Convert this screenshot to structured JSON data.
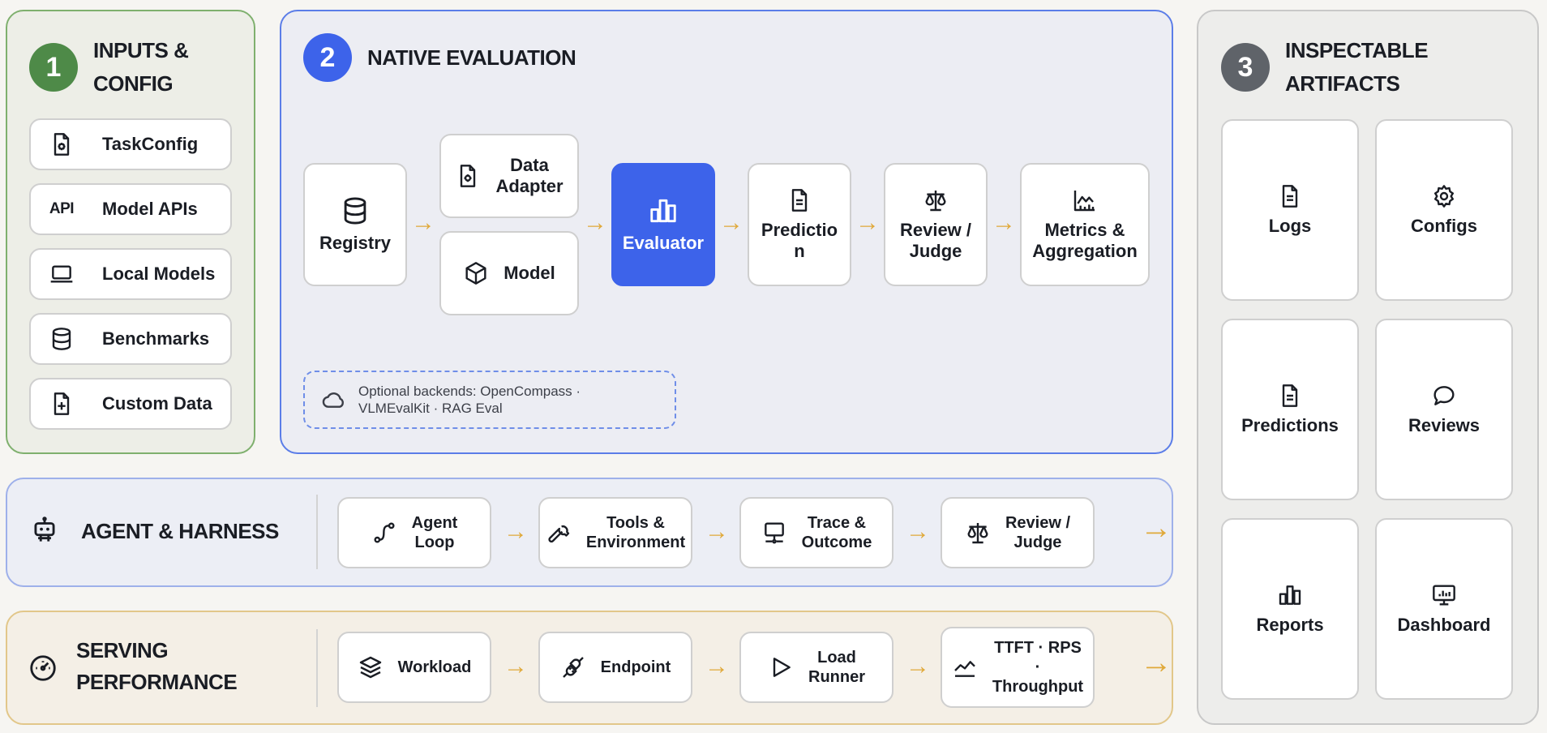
{
  "colors": {
    "inputs_accent": "#4e8a48",
    "native_accent": "#3d63ea",
    "artifacts_accent": "#5f6369",
    "arrow": "#e0a93a"
  },
  "inputs": {
    "number": "1",
    "title_line1": "INPUTS &",
    "title_line2": "CONFIG",
    "items": [
      {
        "label": "TaskConfig",
        "icon": "gear-document-icon"
      },
      {
        "label": "Model APIs",
        "icon": "api-text-icon",
        "icon_text": "API"
      },
      {
        "label": "Local Models",
        "icon": "laptop-icon"
      },
      {
        "label": "Benchmarks",
        "icon": "database-icon"
      },
      {
        "label": "Custom Data",
        "icon": "file-plus-icon"
      }
    ]
  },
  "native": {
    "number": "2",
    "title": "NATIVE EVALUATION",
    "registry": "Registry",
    "data_adapter_line1": "Data",
    "data_adapter_line2": "Adapter",
    "model": "Model",
    "evaluator": "Evaluator",
    "prediction_line1": "Predictio",
    "prediction_line2": "n",
    "review_line1": "Review /",
    "review_line2": "Judge",
    "metrics_line1": "Metrics &",
    "metrics_line2": "Aggregation",
    "backends_text": "Optional backends: OpenCompass · VLMEvalKit · RAG Eval"
  },
  "artifacts": {
    "number": "3",
    "title_line1": "INSPECTABLE",
    "title_line2": "ARTIFACTS",
    "items": [
      {
        "label": "Logs",
        "icon": "document-icon"
      },
      {
        "label": "Configs",
        "icon": "gear-icon"
      },
      {
        "label": "Predictions",
        "icon": "document-icon"
      },
      {
        "label": "Reviews",
        "icon": "chat-bubble-icon"
      },
      {
        "label": "Reports",
        "icon": "bar-chart-icon"
      },
      {
        "label": "Dashboard",
        "icon": "monitor-chart-icon"
      }
    ]
  },
  "agent": {
    "title": "AGENT & HARNESS",
    "steps": [
      {
        "line1": "Agent",
        "line2": "Loop"
      },
      {
        "line1": "Tools &",
        "line2": "Environment"
      },
      {
        "line1": "Trace &",
        "line2": "Outcome"
      },
      {
        "line1": "Review /",
        "line2": "Judge"
      }
    ]
  },
  "serving": {
    "title_line1": "SERVING",
    "title_line2": "PERFORMANCE",
    "steps": [
      {
        "line1": "Workload",
        "line2": ""
      },
      {
        "line1": "Endpoint",
        "line2": ""
      },
      {
        "line1": "Load",
        "line2": "Runner"
      },
      {
        "line1": "TTFT · RPS",
        "line2": "·",
        "line3": "Throughput"
      }
    ]
  }
}
